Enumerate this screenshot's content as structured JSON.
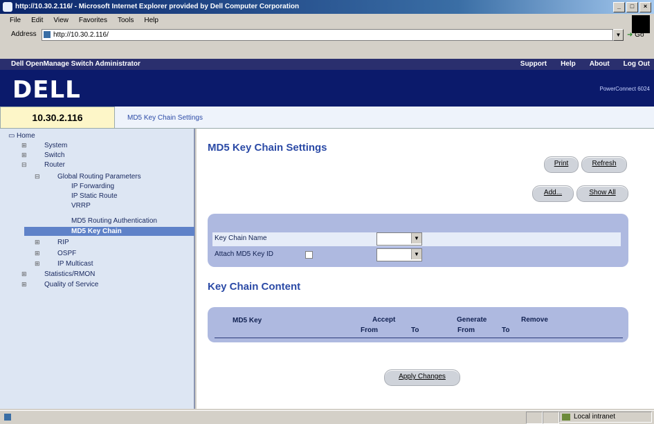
{
  "window": {
    "title": "http://10.30.2.116/ - Microsoft Internet Explorer provided by Dell Computer Corporation",
    "controls": [
      "_",
      "□",
      "×"
    ]
  },
  "menu": [
    "File",
    "Edit",
    "View",
    "Favorites",
    "Tools",
    "Help"
  ],
  "address": {
    "label": "Address",
    "value": "http://10.30.2.116/",
    "go": "Go"
  },
  "app": {
    "title": "Dell OpenManage Switch Administrator",
    "links": [
      "Support",
      "Help",
      "About",
      "Log Out"
    ],
    "logo": "DELL",
    "model": "PowerConnect 6024",
    "ip": "10.30.2.116",
    "breadcrumb": "MD5 Key Chain Settings"
  },
  "tree": {
    "home": "Home",
    "system": "System",
    "switch": "Switch",
    "router": "Router",
    "global": "Global Routing Parameters",
    "ipfwd": "IP Forwarding",
    "static": "IP Static Route",
    "vrrp": "VRRP",
    "md5auth": "MD5 Routing Authentication",
    "md5chain": "MD5 Key Chain",
    "rip": "RIP",
    "ospf": "OSPF",
    "mcast": "IP Multicast",
    "stats": "Statistics/RMON",
    "qos": "Quality of Service"
  },
  "page": {
    "title": "MD5 Key Chain Settings",
    "buttons": {
      "print": "Print",
      "refresh": "Refresh",
      "add": "Add...",
      "show_all": "Show All",
      "apply": "Apply Changes"
    },
    "form": {
      "key_chain_name": "Key Chain Name",
      "attach_key_id": "Attach MD5 Key ID"
    },
    "section2": "Key Chain Content",
    "table": {
      "md5_key": "MD5 Key",
      "accept": "Accept",
      "generate": "Generate",
      "remove": "Remove",
      "from": "From",
      "to": "To"
    }
  },
  "status": {
    "zone": "Local intranet"
  }
}
